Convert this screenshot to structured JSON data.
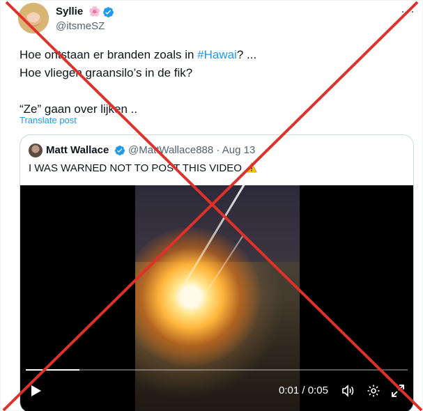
{
  "tweet": {
    "author_name": "Syllie",
    "author_emoji": "🌸",
    "author_handle": "@itsmeSZ",
    "text_line1_before": "Hoe ontstaan er branden zoals in ",
    "text_line1_hashtag": "#Hawai",
    "text_line1_after": "? ...",
    "text_line2": "Hoe vliegen graansilo’s in de fik?",
    "text_line3": "“Ze” gaan over lijken ..",
    "translate_label": "Translate post"
  },
  "quote": {
    "author_name": "Matt Wallace",
    "author_handle": "@MattWallace888",
    "separator": "·",
    "date": "Aug 13",
    "text": "I WAS WARNED NOT TO POST THIS VIDEO"
  },
  "video": {
    "current_time": "0:01",
    "duration": "0:05",
    "progress_fraction": 0.14
  },
  "colors": {
    "accent": "#1d9bf0",
    "secondary_text": "#536471",
    "cross": "#e0302a"
  },
  "icons": [
    "more-icon",
    "verified-icon",
    "warning-icon",
    "play-icon",
    "volume-icon",
    "gear-icon",
    "expand-icon"
  ]
}
